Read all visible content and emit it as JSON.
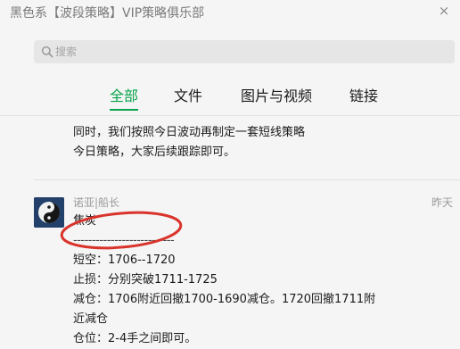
{
  "window": {
    "title": "黑色系【波段策略】VIP策略俱乐部",
    "close_glyph": "×"
  },
  "search": {
    "placeholder": "搜索"
  },
  "tabs": [
    {
      "label": "全部",
      "active": true
    },
    {
      "label": "文件",
      "active": false
    },
    {
      "label": "图片与视频",
      "active": false
    },
    {
      "label": "链接",
      "active": false
    }
  ],
  "accent_color": "#07a44b",
  "annotation_color": "#d9342b",
  "previous_message": {
    "lines": [
      "同时，我们按照今日波动再制定一套短线策略",
      "今日策略，大家后续跟踪即可。"
    ]
  },
  "message": {
    "avatar": "taiji-icon",
    "sender": "诺亚|船长",
    "time": "昨天",
    "lines": [
      "焦炭",
      "---------------------------",
      "短空：1706--1720",
      "止损：分别突破1711-1725",
      "减仓：1706附近回撤1700-1690减仓。1720回撤1711附",
      "近减仓",
      "仓位：2-4手之间即可。"
    ]
  }
}
